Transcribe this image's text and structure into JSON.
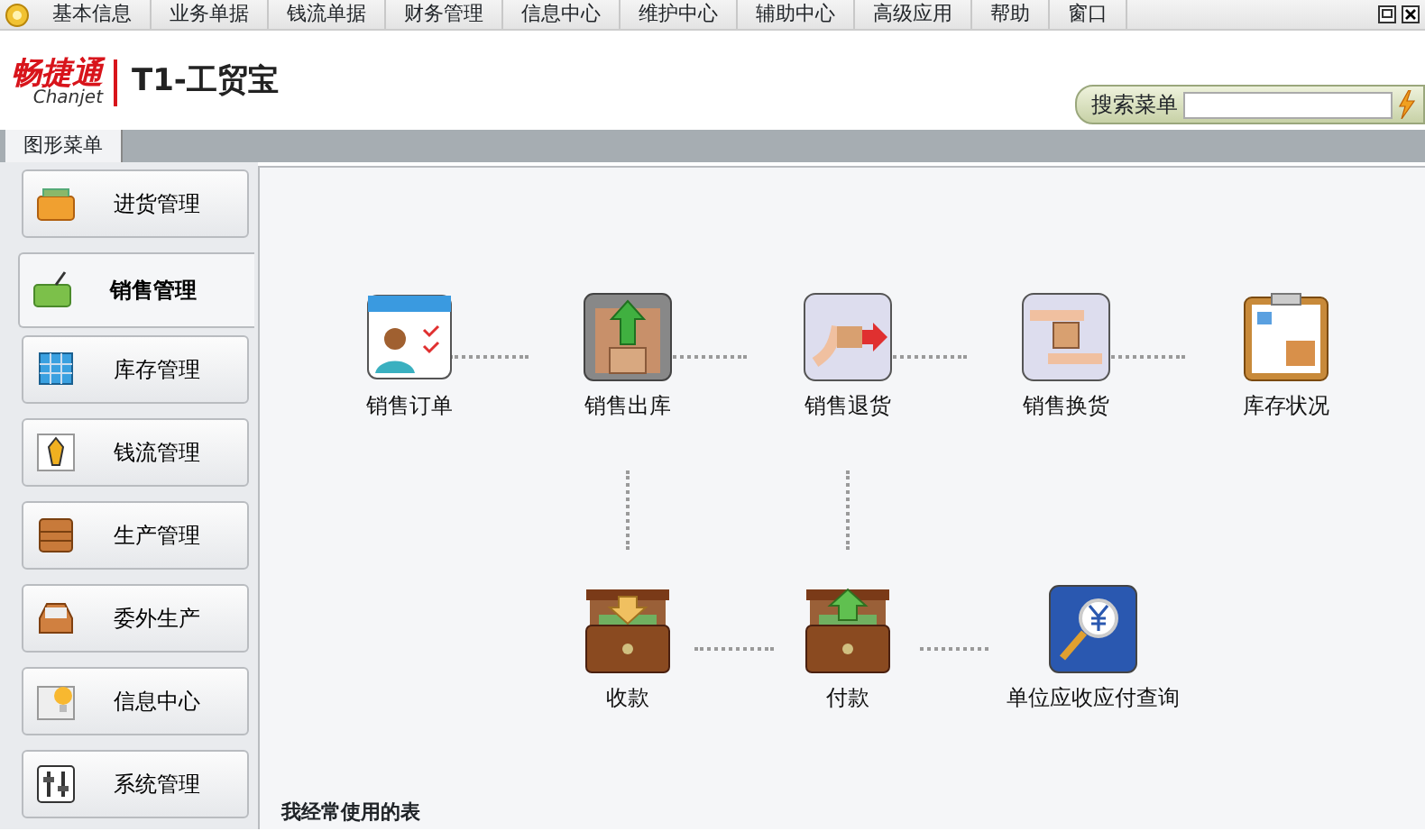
{
  "menu_bar": [
    "基本信息",
    "业务单据",
    "钱流单据",
    "财务管理",
    "信息中心",
    "维护中心",
    "辅助中心",
    "高级应用",
    "帮助",
    "窗口"
  ],
  "logo": {
    "brand": "畅捷通",
    "brand_latin": "Chanjet",
    "product": "T1-工贸宝"
  },
  "search": {
    "label": "搜索菜单"
  },
  "tabs": [
    {
      "label": "图形菜单",
      "selected": true
    }
  ],
  "sidebar": [
    {
      "label": "进货管理",
      "selected": false
    },
    {
      "label": "销售管理",
      "selected": true
    },
    {
      "label": "库存管理",
      "selected": false
    },
    {
      "label": "钱流管理",
      "selected": false
    },
    {
      "label": "生产管理",
      "selected": false
    },
    {
      "label": "委外生产",
      "selected": false
    },
    {
      "label": "信息中心",
      "selected": false
    },
    {
      "label": "系统管理",
      "selected": false
    }
  ],
  "flow": [
    {
      "label": "销售订单"
    },
    {
      "label": "销售出库"
    },
    {
      "label": "销售退货"
    },
    {
      "label": "销售换货"
    },
    {
      "label": "库存状况"
    },
    {
      "label": "收款"
    },
    {
      "label": "付款"
    },
    {
      "label": "单位应收应付查询"
    }
  ],
  "frequent_heading": "我经常使用的表"
}
